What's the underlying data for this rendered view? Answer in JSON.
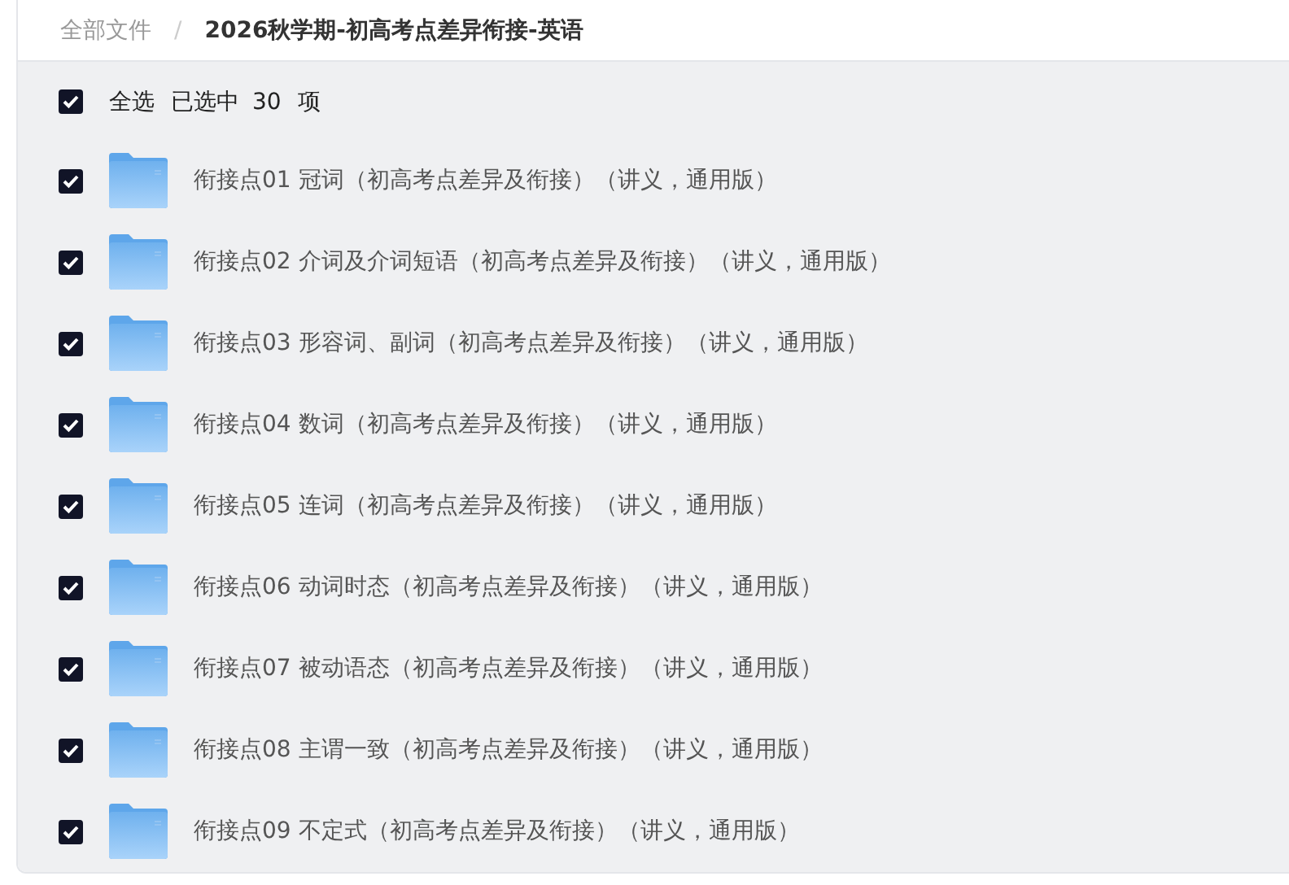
{
  "breadcrumb": [
    {
      "label": "全部文件",
      "current": false
    },
    {
      "label": "2026秋学期-初高考点差异衔接-英语",
      "current": true
    }
  ],
  "breadcrumb_separator": "/",
  "select_all": {
    "checked": true,
    "label": "全选",
    "count_text": "已选中",
    "count": "30",
    "unit": "项"
  },
  "files": [
    {
      "name": "衔接点01 冠词（初高考点差异及衔接）（讲义，通用版）",
      "checked": true
    },
    {
      "name": "衔接点02 介词及介词短语（初高考点差异及衔接）（讲义，通用版）",
      "checked": true
    },
    {
      "name": "衔接点03 形容词、副词（初高考点差异及衔接）（讲义，通用版）",
      "checked": true
    },
    {
      "name": "衔接点04 数词（初高考点差异及衔接）（讲义，通用版）",
      "checked": true
    },
    {
      "name": "衔接点05 连词（初高考点差异及衔接）（讲义，通用版）",
      "checked": true
    },
    {
      "name": "衔接点06 动词时态（初高考点差异及衔接）（讲义，通用版）",
      "checked": true
    },
    {
      "name": "衔接点07 被动语态（初高考点差异及衔接）（讲义，通用版）",
      "checked": true
    },
    {
      "name": "衔接点08 主谓一致（初高考点差异及衔接）（讲义，通用版）",
      "checked": true
    },
    {
      "name": "衔接点09 不定式（初高考点差异及衔接）（讲义，通用版）",
      "checked": true
    }
  ]
}
